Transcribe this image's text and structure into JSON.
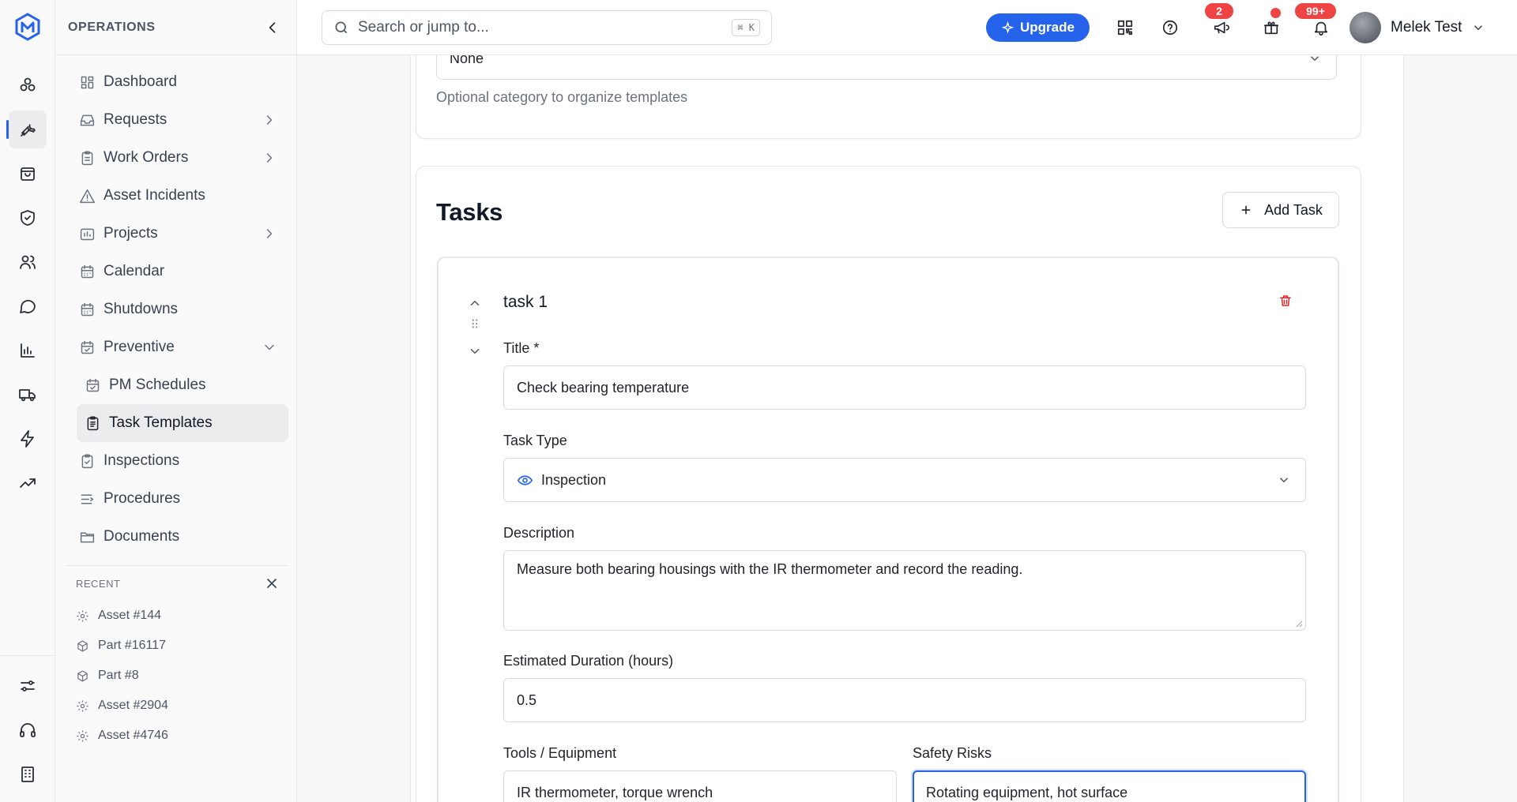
{
  "rail": {
    "items": [
      {
        "name": "assets-icon"
      },
      {
        "name": "operations-wrench-icon",
        "active": true
      },
      {
        "name": "inventory-bag-icon"
      },
      {
        "name": "safety-shield-icon"
      },
      {
        "name": "users-icon"
      },
      {
        "name": "messages-icon"
      },
      {
        "name": "analytics-icon"
      },
      {
        "name": "fleet-truck-icon"
      },
      {
        "name": "automations-bolt-icon"
      },
      {
        "name": "trends-icon"
      }
    ],
    "bottom": [
      {
        "name": "settings-sliders-icon"
      },
      {
        "name": "support-headset-icon"
      },
      {
        "name": "organization-building-icon"
      }
    ]
  },
  "sidebar": {
    "section_title": "OPERATIONS",
    "items": [
      {
        "label": "Dashboard",
        "icon": "dashboard-icon"
      },
      {
        "label": "Requests",
        "icon": "inbox-icon",
        "has_children": true
      },
      {
        "label": "Work Orders",
        "icon": "clipboard-icon",
        "has_children": true
      },
      {
        "label": "Asset Incidents",
        "icon": "warning-icon"
      },
      {
        "label": "Projects",
        "icon": "projects-icon",
        "has_children": true
      },
      {
        "label": "Calendar",
        "icon": "calendar-icon"
      },
      {
        "label": "Shutdowns",
        "icon": "calendar-icon"
      },
      {
        "label": "Preventive",
        "icon": "calendar-check-icon",
        "expanded": true
      },
      {
        "label": "PM Schedules",
        "icon": "calendar-check-icon",
        "sub": true
      },
      {
        "label": "Task Templates",
        "icon": "clipboard-list-icon",
        "sub": true,
        "active": true
      },
      {
        "label": "Inspections",
        "icon": "clipboard-check-icon"
      },
      {
        "label": "Procedures",
        "icon": "list-icon"
      },
      {
        "label": "Documents",
        "icon": "folder-icon"
      }
    ],
    "recent_title": "RECENT",
    "recent": [
      {
        "label": "Asset #144",
        "icon": "gear-icon"
      },
      {
        "label": "Part #16117",
        "icon": "box-icon"
      },
      {
        "label": "Part #8",
        "icon": "box-icon"
      },
      {
        "label": "Asset #2904",
        "icon": "gear-icon"
      },
      {
        "label": "Asset #4746",
        "icon": "gear-icon"
      }
    ]
  },
  "topbar": {
    "search_placeholder": "Search or jump to...",
    "search_shortcut": "⌘ K",
    "upgrade_label": "Upgrade",
    "announcements_count": "2",
    "notifications_count": "99+",
    "user_name": "Melek Test",
    "accent": "#2563eb",
    "badge_color": "#ef4444"
  },
  "form": {
    "category_value": "None",
    "category_hint": "Optional category to organize templates",
    "tasks_title": "Tasks",
    "add_task_label": "Add Task",
    "task": {
      "name": "task 1",
      "title_label": "Title *",
      "title_value": "Check bearing temperature",
      "type_label": "Task Type",
      "type_value": "Inspection",
      "description_label": "Description",
      "description_value": "Measure both bearing housings with the IR thermometer and record the reading.",
      "duration_label": "Estimated Duration (hours)",
      "duration_value": "0.5",
      "tools_label": "Tools / Equipment",
      "tools_value": "IR thermometer, torque wrench",
      "risks_label": "Safety Risks",
      "risks_value": "Rotating equipment, hot surface"
    }
  }
}
